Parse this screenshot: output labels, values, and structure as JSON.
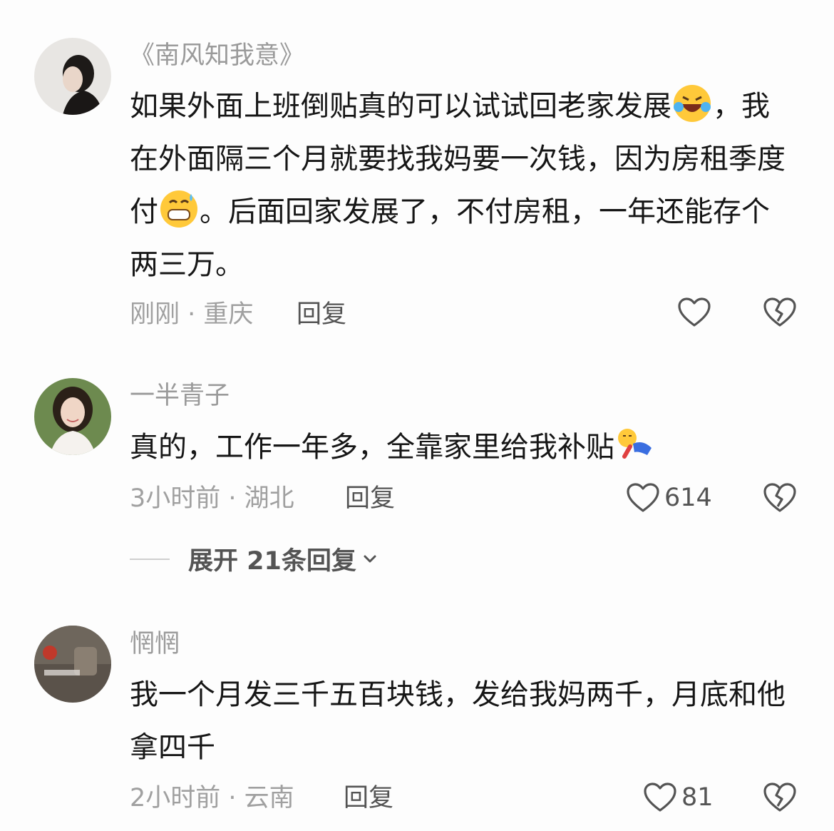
{
  "comments": [
    {
      "username": "《南风知我意》",
      "text_parts": [
        "如果外面上班倒贴真的可以试试回老家发展",
        "，我在外面隔三个月就要找我妈要一次钱，因为房租季度付",
        "。后面回家发展了，不付房租，一年还能存个两三万。"
      ],
      "emojis": [
        "laughing-crying-emoji",
        "grinning-sweat-emoji"
      ],
      "meta": "刚刚 · 重庆",
      "reply_label": "回复",
      "like_count": ""
    },
    {
      "username": "一半青子",
      "text_parts": [
        "真的，工作一年多，全靠家里给我补贴"
      ],
      "emojis": [
        "lying-down-emoji"
      ],
      "meta": "3小时前 · 湖北",
      "reply_label": "回复",
      "like_count": "614",
      "expand_label": "展开 21条回复"
    },
    {
      "username": "惘惘",
      "text_parts": [
        "我一个月发三千五百块钱，发给我妈两千，月底和他拿四千"
      ],
      "emojis": [],
      "meta": "2小时前 · 云南",
      "reply_label": "回复",
      "like_count": "81"
    }
  ],
  "colors": {
    "text": "#161616",
    "muted": "#a0a0a0",
    "action": "#545454"
  },
  "icons": [
    "heart-outline-icon",
    "broken-heart-icon",
    "chevron-down-icon"
  ]
}
